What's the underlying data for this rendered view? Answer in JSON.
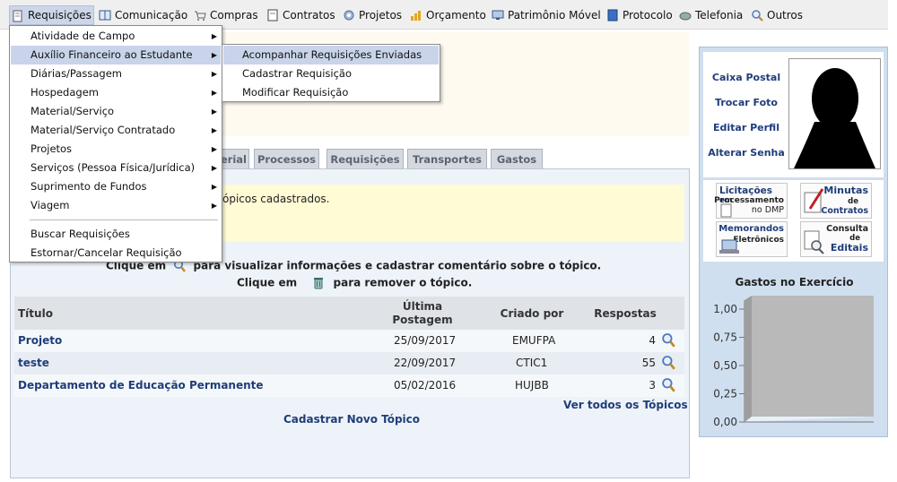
{
  "menubar": {
    "items": [
      {
        "label": "Requisições",
        "icon": "document-icon"
      },
      {
        "label": "Comunicação",
        "icon": "book-icon"
      },
      {
        "label": "Compras",
        "icon": "cart-icon"
      },
      {
        "label": "Contratos",
        "icon": "contract-icon"
      },
      {
        "label": "Projetos",
        "icon": "projects-icon"
      },
      {
        "label": "Orçamento",
        "icon": "budget-icon"
      },
      {
        "label": "Patrimônio Móvel",
        "icon": "monitor-icon"
      },
      {
        "label": "Protocolo",
        "icon": "protocol-icon"
      },
      {
        "label": "Telefonia",
        "icon": "phone-icon"
      },
      {
        "label": "Outros",
        "icon": "search-icon"
      }
    ]
  },
  "requisicoes_menu": {
    "items": [
      {
        "label": "Atividade de Campo"
      },
      {
        "label": "Auxílio Financeiro ao Estudante"
      },
      {
        "label": "Diárias/Passagem"
      },
      {
        "label": "Hospedagem"
      },
      {
        "label": "Material/Serviço"
      },
      {
        "label": "Material/Serviço Contratado"
      },
      {
        "label": "Projetos"
      },
      {
        "label": "Serviços (Pessoa Física/Jurídica)"
      },
      {
        "label": "Suprimento de Fundos"
      },
      {
        "label": "Viagem"
      },
      {
        "label": "Buscar Requisições"
      },
      {
        "label": "Estornar/Cancelar Requisição"
      }
    ]
  },
  "auxilio_submenu": {
    "items": [
      {
        "label": "Acompanhar Requisições Enviadas"
      },
      {
        "label": "Cadastrar Requisição"
      },
      {
        "label": "Modificar Requisição"
      }
    ]
  },
  "tabs": [
    {
      "label": "erial"
    },
    {
      "label": "Processos"
    },
    {
      "label": "Requisições"
    },
    {
      "label": "Transportes"
    },
    {
      "label": "Gastos"
    }
  ],
  "notice": "ópicos cadastrados.",
  "instructions": {
    "line1_pre": "Clique em",
    "line1_post": "para visualizar informações e cadastrar comentário sobre o tópico.",
    "line2_pre": "Clique em",
    "line2_post": "para remover o tópico."
  },
  "table": {
    "headers": {
      "titulo": "Título",
      "ultima_line1": "Última",
      "ultima_line2": "Postagem",
      "criado": "Criado por",
      "respostas": "Respostas"
    },
    "rows": [
      {
        "titulo": "Projeto",
        "data": "25/09/2017",
        "criado": "EMUFPA",
        "respostas": "4"
      },
      {
        "titulo": "teste",
        "data": "22/09/2017",
        "criado": "CTIC1",
        "respostas": "55"
      },
      {
        "titulo": "Departamento de Educação Permanente",
        "data": "05/02/2016",
        "criado": "HUJBB",
        "respostas": "3"
      }
    ],
    "ver_todos": "Ver todos os Tópicos",
    "cadastrar": "Cadastrar Novo Tópico"
  },
  "sidebar": {
    "profile_links": [
      "Caixa Postal",
      "Trocar Foto",
      "Editar Perfil",
      "Alterar Senha"
    ],
    "shortcuts": {
      "licitacoes": [
        "Licitações",
        "em",
        "Processamento",
        "no DMP"
      ],
      "minutas": [
        "Minutas",
        "de",
        "Contratos"
      ],
      "memorandos": [
        "Memorandos",
        "Eletrônicos"
      ],
      "consulta": [
        "Consulta",
        "de",
        "Editais"
      ]
    },
    "gastos_title": "Gastos no Exercício",
    "gastos_ticks": [
      "1,00",
      "0,75",
      "0,50",
      "0,25",
      "0,00"
    ]
  },
  "chart_data": {
    "type": "bar",
    "categories": [],
    "series": [],
    "title": "Gastos no Exercício",
    "ylim": [
      0,
      1
    ],
    "yticks": [
      "0,00",
      "0,25",
      "0,50",
      "0,75",
      "1,00"
    ]
  }
}
